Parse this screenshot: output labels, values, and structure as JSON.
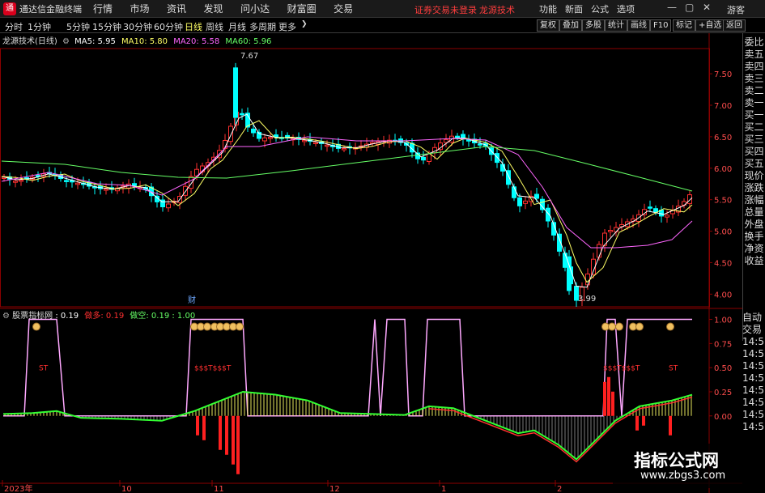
{
  "window": {
    "app_name": "通达信金融终端",
    "menus": [
      "行情",
      "市场",
      "资讯",
      "发现",
      "问小达",
      "财富圈",
      "交易"
    ],
    "notice": "证券交易未登录",
    "brand_link": "龙源技术",
    "top_actions": [
      "功能",
      "新面",
      "公式",
      "选项"
    ],
    "guest": "游客"
  },
  "toolbar": {
    "periods": [
      "分时",
      "1分钟",
      "5分钟",
      "15分钟",
      "30分钟",
      "60分钟",
      "日线",
      "周线",
      "月线",
      "多周期",
      "更多"
    ],
    "active_period": "日线",
    "right_buttons": [
      "复权",
      "叠加",
      "多股",
      "统计",
      "画线",
      "F10",
      "标记",
      "+自选",
      "返回"
    ]
  },
  "main_chart": {
    "title": "龙源技术(日线)",
    "ma5_label": "MA5: 5.95",
    "ma10_label": "MA10: 5.80",
    "ma20_label": "MA20: 5.58",
    "ma60_label": "MA60: 5.96",
    "high_label": "7.67",
    "low_label": "3.99",
    "cai_label": "财",
    "y_ticks": [
      "7.50",
      "7.00",
      "6.50",
      "6.00",
      "5.50",
      "5.00",
      "4.50",
      "4.00"
    ],
    "colors": {
      "ma5": "#ffffff",
      "ma10": "#ffff66",
      "ma20": "#ff66ff",
      "ma60": "#66ff66",
      "up": "#ff3030",
      "down": "#00ffff"
    }
  },
  "right_panel": [
    "委比",
    "卖五",
    "卖四",
    "卖三",
    "卖二",
    "卖一",
    "买一",
    "买二",
    "买三",
    "买四",
    "买五",
    "现价",
    "涨跌",
    "涨幅",
    "总量",
    "外盘",
    "换手",
    "净资",
    "收益"
  ],
  "right_panel2": [
    "自动",
    "交易",
    "14:5",
    "14:5",
    "14:5",
    "14:5",
    "14:5",
    "14:5",
    "14:5",
    "14:5"
  ],
  "indicator": {
    "name": "股票指标网",
    "val": ": 0.19",
    "duo_label": "做多:",
    "duo_val": " 0.19",
    "kong_label": "做空:",
    "kong_val": " 0.19 : 1.00",
    "y_ticks": [
      "1.00",
      "0.75",
      "0.50",
      "0.25",
      "0.00"
    ],
    "st_label": "ST",
    "st_multi": "$$$T$$$T",
    "st_multi2": "$$$T$$$T"
  },
  "x_axis": [
    "2023年",
    "10",
    "11",
    "12",
    "1",
    "2"
  ],
  "watermark": {
    "line1": "指标公式网",
    "line2": "www.zbgs3.com"
  }
}
